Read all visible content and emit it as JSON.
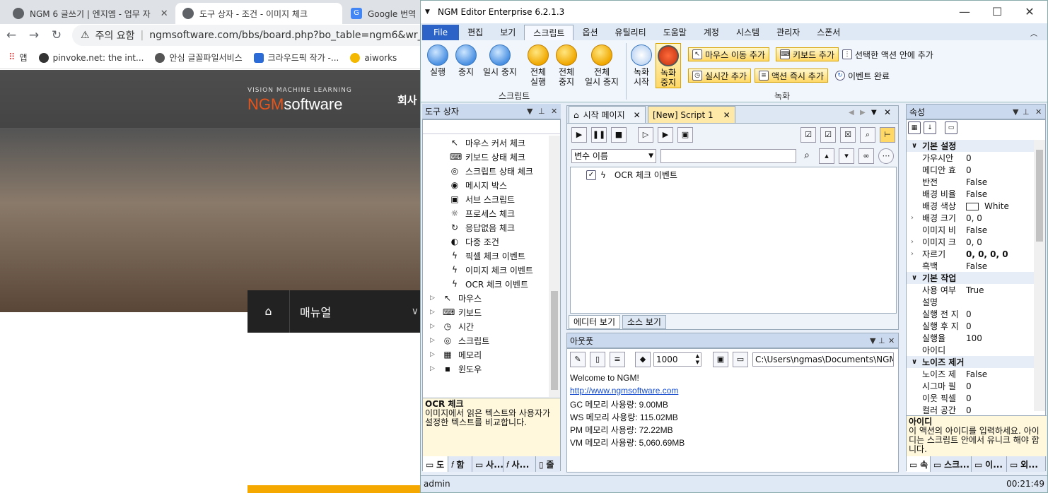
{
  "browser": {
    "tabs": [
      {
        "title": "NGM 6 글쓰기 | 엔지엠 - 업무 자"
      },
      {
        "title": "도구 상자 - 조건 - 이미지 체크"
      },
      {
        "title": "Google 번역"
      }
    ],
    "security": "주의 요함",
    "url": "ngmsoftware.com/bbs/board.php?bo_table=ngm6&wr_id=",
    "bookmarks": [
      "앱",
      "pinvoke.net: the int...",
      "안심 글꼴파일서비스",
      "크라우드픽 작가 -...",
      "aiworks"
    ],
    "page": {
      "tagline": "VISION MACHINE LEARNING",
      "logo_a": "NGM",
      "logo_b": "software",
      "nav": "회사",
      "menu_label": "매뉴얼"
    }
  },
  "app": {
    "title": "NGM Editor   Enterprise 6.2.1.3",
    "ribbon_tabs": [
      "File",
      "편집",
      "보기",
      "스크립트",
      "옵션",
      "유틸리티",
      "도움말",
      "계정",
      "시스템",
      "관리자",
      "스폰서"
    ],
    "script_group": {
      "buttons": [
        "실행",
        "중지",
        "일시 중지"
      ],
      "all_buttons": [
        [
          "전체",
          "실행"
        ],
        [
          "전체",
          "중지"
        ],
        [
          "전체",
          "일시 중지"
        ]
      ],
      "label": "스크립트"
    },
    "record_group": {
      "buttons": [
        [
          "녹화",
          "시작"
        ],
        [
          "녹화",
          "중지"
        ]
      ],
      "small": [
        "마우스 이동 추가",
        "키보드 추가",
        "선택한 액션 안에 추가",
        "실시간 추가",
        "액션 즉시 추가",
        "이벤트 완료"
      ],
      "label": "녹화"
    },
    "toolbox": {
      "title": "도구 상자",
      "items": [
        {
          "label": "마우스 커서 체크",
          "icon": "↖"
        },
        {
          "label": "키보드 상태 체크",
          "icon": "⌨"
        },
        {
          "label": "스크립트 상태 체크",
          "icon": "◎"
        },
        {
          "label": "메시지 박스",
          "icon": "◉"
        },
        {
          "label": "서브 스크립트",
          "icon": "▣"
        },
        {
          "label": "프로세스 체크",
          "icon": "☼"
        },
        {
          "label": "응답없음 체크",
          "icon": "↻"
        },
        {
          "label": "다중 조건",
          "icon": "◐"
        },
        {
          "label": "픽셀 체크 이벤트",
          "icon": "ϟ"
        },
        {
          "label": "이미지 체크 이벤트",
          "icon": "ϟ"
        },
        {
          "label": "OCR 체크 이벤트",
          "icon": "ϟ"
        }
      ],
      "groups": [
        {
          "label": "마우스",
          "icon": "↖"
        },
        {
          "label": "키보드",
          "icon": "⌨"
        },
        {
          "label": "시간",
          "icon": "◷"
        },
        {
          "label": "스크립트",
          "icon": "◎"
        },
        {
          "label": "메모리",
          "icon": "▦"
        },
        {
          "label": "윈도우",
          "icon": "▪"
        }
      ],
      "desc_title": "OCR 체크",
      "desc_text": "이미지에서 읽은 텍스트와 사용자가 설정한 텍스트를 비교합니다.",
      "bottom_tabs": [
        "도",
        "함",
        "사...",
        "사...",
        "줄"
      ]
    },
    "editor": {
      "tabs": [
        "시작 페이지",
        "[New] Script 1"
      ],
      "var_select": "변수 이름",
      "events": [
        {
          "label": "OCR 체크 이벤트",
          "checked": true
        }
      ],
      "view_tabs": [
        "에디터 보기",
        "소스 보기"
      ]
    },
    "output": {
      "title": "아웃풋",
      "count": "1000",
      "path": "C:\\Users\\ngmas\\Documents\\NGM6\\",
      "lines": [
        "Welcome to NGM!",
        "http://www.ngmsoftware.com",
        "GC 메모리 사용량: 9.00MB",
        "WS 메모리 사용량: 115.02MB",
        "PM 메모리 사용량: 72.22MB",
        "VM 메모리 사용량: 5,060.69MB"
      ]
    },
    "properties": {
      "title": "속성",
      "rows": [
        {
          "cat": "기본 설정"
        },
        {
          "name": "가우시안",
          "value": "0"
        },
        {
          "name": "메디안 효",
          "value": "0"
        },
        {
          "name": "반전",
          "value": "False"
        },
        {
          "name": "배경 비율",
          "value": "False"
        },
        {
          "name": "배경 색상",
          "value": "White",
          "swatch": "#ffffff"
        },
        {
          "name": "배경 크기",
          "value": "0, 0",
          "exp": true
        },
        {
          "name": "이미지 비",
          "value": "False"
        },
        {
          "name": "이미지 크",
          "value": "0, 0",
          "exp": true
        },
        {
          "name": "자르기",
          "value": "0, 0, 0, 0",
          "exp": true,
          "bold": true
        },
        {
          "name": "흑백",
          "value": "False"
        },
        {
          "cat": "기본 작업"
        },
        {
          "name": "사용 여부",
          "value": "True"
        },
        {
          "name": "설명",
          "value": ""
        },
        {
          "name": "실행 전 지",
          "value": "0"
        },
        {
          "name": "실행 후 지",
          "value": "0"
        },
        {
          "name": "실행율",
          "value": "100"
        },
        {
          "name": "아이디",
          "value": ""
        },
        {
          "cat": "노이즈 제거"
        },
        {
          "name": "노이즈 제",
          "value": "False"
        },
        {
          "name": "시그마 필",
          "value": "0"
        },
        {
          "name": "이웃 픽셀",
          "value": "0"
        },
        {
          "name": "컬러 공간",
          "value": "0"
        }
      ],
      "desc_title": "아이디",
      "desc_text": "이 액션의 아이디를 입력하세요. 아이디는 스크립트 안에서 유니크 해야 합니다.",
      "bottom_tabs": [
        "속",
        "스크...",
        "이...",
        "외..."
      ]
    },
    "status": {
      "user": "admin",
      "time": "00:21:49"
    }
  }
}
